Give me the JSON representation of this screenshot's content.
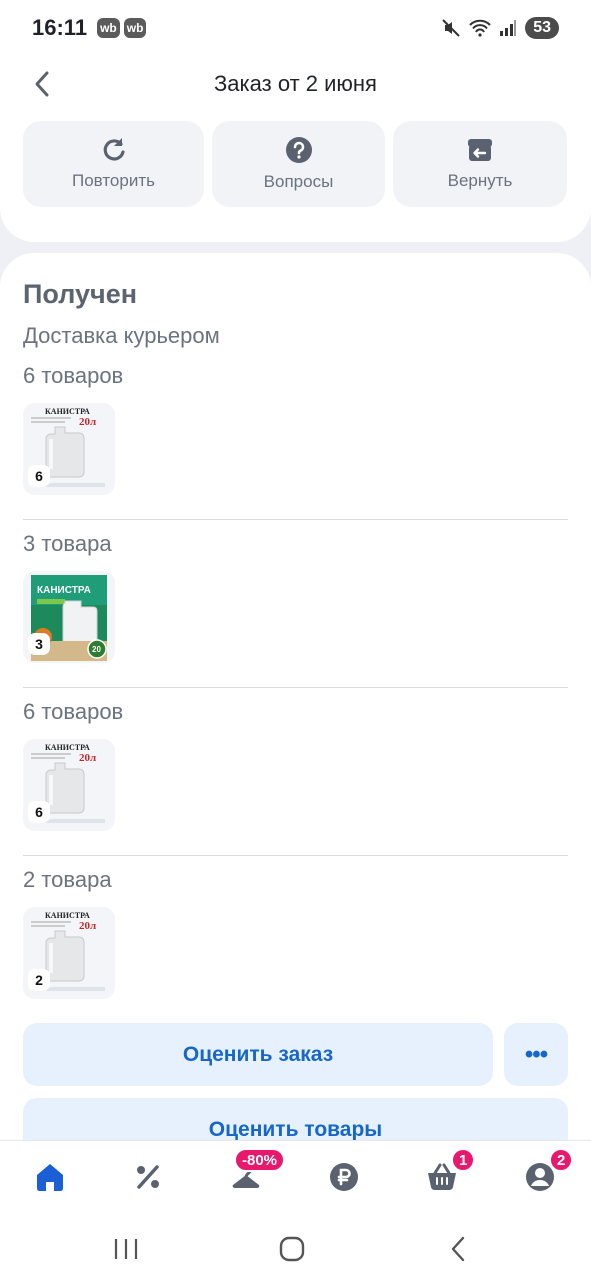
{
  "status_bar": {
    "time": "16:11",
    "app_badges": [
      "wb",
      "wb"
    ],
    "battery": "53"
  },
  "header": {
    "title": "Заказ от 2 июня"
  },
  "actions": [
    {
      "label": "Повторить",
      "icon": "repeat-icon"
    },
    {
      "label": "Вопросы",
      "icon": "question-icon"
    },
    {
      "label": "Вернуть",
      "icon": "return-icon"
    }
  ],
  "order": {
    "status": "Получен",
    "delivery": "Доставка курьером",
    "groups": [
      {
        "count_text": "6 товаров",
        "qty": "6",
        "product_image": "white-canister-20l"
      },
      {
        "count_text": "3 товара",
        "qty": "3",
        "product_image": "green-canister-20l"
      },
      {
        "count_text": "6 товаров",
        "qty": "6",
        "product_image": "white-canister-20l"
      },
      {
        "count_text": "2 товара",
        "qty": "2",
        "product_image": "white-canister-20l"
      }
    ],
    "product_label_text": "КАНИСТРА",
    "product_volume": "20л",
    "product_volume_green": "20"
  },
  "buttons": {
    "rate_order": "Оценить заказ",
    "more": "•••",
    "rate_goods": "Оценить товары"
  },
  "bottom_nav": [
    {
      "icon": "home-icon",
      "active": true
    },
    {
      "icon": "discount-icon"
    },
    {
      "icon": "hanger-icon",
      "badge": "-80%"
    },
    {
      "icon": "ruble-icon"
    },
    {
      "icon": "basket-icon",
      "badge": "1"
    },
    {
      "icon": "profile-icon",
      "badge": "2"
    }
  ],
  "colors": {
    "accent": "#1667c9",
    "nav_active": "#1a5fd6",
    "badge": "#e8186d",
    "button_bg": "#e6f1fd"
  }
}
